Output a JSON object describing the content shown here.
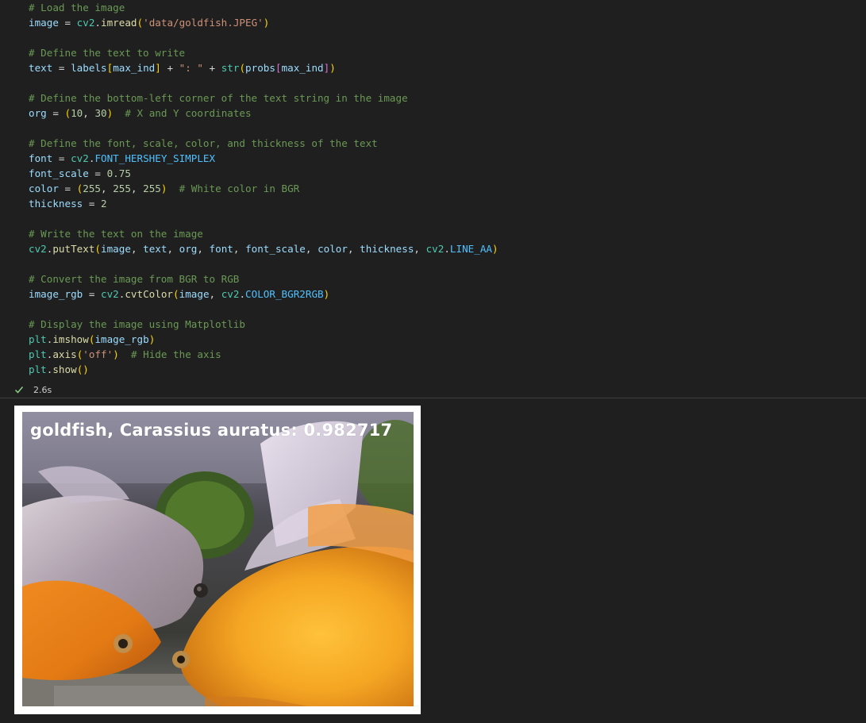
{
  "code_cell": {
    "lines": [
      {
        "segs": [
          [
            "c",
            "# Load the image"
          ]
        ]
      },
      {
        "segs": [
          [
            "v",
            "image"
          ],
          [
            "o",
            " = "
          ],
          [
            "m",
            "cv2"
          ],
          [
            "o",
            "."
          ],
          [
            "f",
            "imread"
          ],
          [
            "p1",
            "("
          ],
          [
            "s",
            "'data/goldfish.JPEG'"
          ],
          [
            "p1",
            ")"
          ]
        ]
      },
      {
        "segs": []
      },
      {
        "segs": [
          [
            "c",
            "# Define the text to write"
          ]
        ]
      },
      {
        "segs": [
          [
            "v",
            "text"
          ],
          [
            "o",
            " = "
          ],
          [
            "v",
            "labels"
          ],
          [
            "p1",
            "["
          ],
          [
            "v",
            "max_ind"
          ],
          [
            "p1",
            "]"
          ],
          [
            "o",
            " + "
          ],
          [
            "s",
            "\": \""
          ],
          [
            "o",
            " + "
          ],
          [
            "m",
            "str"
          ],
          [
            "p1",
            "("
          ],
          [
            "v",
            "probs"
          ],
          [
            "p2",
            "["
          ],
          [
            "v",
            "max_ind"
          ],
          [
            "p2",
            "]"
          ],
          [
            "p1",
            ")"
          ]
        ]
      },
      {
        "segs": []
      },
      {
        "segs": [
          [
            "c",
            "# Define the bottom-left corner of the text string in the image"
          ]
        ]
      },
      {
        "segs": [
          [
            "v",
            "org"
          ],
          [
            "o",
            " = "
          ],
          [
            "p1",
            "("
          ],
          [
            "n",
            "10"
          ],
          [
            "o",
            ", "
          ],
          [
            "n",
            "30"
          ],
          [
            "p1",
            ")"
          ],
          [
            "o",
            "  "
          ],
          [
            "c",
            "# X and Y coordinates"
          ]
        ]
      },
      {
        "segs": []
      },
      {
        "segs": [
          [
            "c",
            "# Define the font, scale, color, and thickness of the text"
          ]
        ]
      },
      {
        "segs": [
          [
            "v",
            "font"
          ],
          [
            "o",
            " = "
          ],
          [
            "m",
            "cv2"
          ],
          [
            "o",
            "."
          ],
          [
            "k",
            "FONT_HERSHEY_SIMPLEX"
          ]
        ]
      },
      {
        "segs": [
          [
            "v",
            "font_scale"
          ],
          [
            "o",
            " = "
          ],
          [
            "n",
            "0.75"
          ]
        ]
      },
      {
        "segs": [
          [
            "v",
            "color"
          ],
          [
            "o",
            " = "
          ],
          [
            "p1",
            "("
          ],
          [
            "n",
            "255"
          ],
          [
            "o",
            ", "
          ],
          [
            "n",
            "255"
          ],
          [
            "o",
            ", "
          ],
          [
            "n",
            "255"
          ],
          [
            "p1",
            ")"
          ],
          [
            "o",
            "  "
          ],
          [
            "c",
            "# White color in BGR"
          ]
        ]
      },
      {
        "segs": [
          [
            "v",
            "thickness"
          ],
          [
            "o",
            " = "
          ],
          [
            "n",
            "2"
          ]
        ]
      },
      {
        "segs": []
      },
      {
        "segs": [
          [
            "c",
            "# Write the text on the image"
          ]
        ]
      },
      {
        "segs": [
          [
            "m",
            "cv2"
          ],
          [
            "o",
            "."
          ],
          [
            "f",
            "putText"
          ],
          [
            "p1",
            "("
          ],
          [
            "v",
            "image"
          ],
          [
            "o",
            ", "
          ],
          [
            "v",
            "text"
          ],
          [
            "o",
            ", "
          ],
          [
            "v",
            "org"
          ],
          [
            "o",
            ", "
          ],
          [
            "v",
            "font"
          ],
          [
            "o",
            ", "
          ],
          [
            "v",
            "font_scale"
          ],
          [
            "o",
            ", "
          ],
          [
            "v",
            "color"
          ],
          [
            "o",
            ", "
          ],
          [
            "v",
            "thickness"
          ],
          [
            "o",
            ", "
          ],
          [
            "m",
            "cv2"
          ],
          [
            "o",
            "."
          ],
          [
            "k",
            "LINE_AA"
          ],
          [
            "p1",
            ")"
          ]
        ]
      },
      {
        "segs": []
      },
      {
        "segs": [
          [
            "c",
            "# Convert the image from BGR to RGB"
          ]
        ]
      },
      {
        "segs": [
          [
            "v",
            "image_rgb"
          ],
          [
            "o",
            " = "
          ],
          [
            "m",
            "cv2"
          ],
          [
            "o",
            "."
          ],
          [
            "f",
            "cvtColor"
          ],
          [
            "p1",
            "("
          ],
          [
            "v",
            "image"
          ],
          [
            "o",
            ", "
          ],
          [
            "m",
            "cv2"
          ],
          [
            "o",
            "."
          ],
          [
            "k",
            "COLOR_BGR2RGB"
          ],
          [
            "p1",
            ")"
          ]
        ]
      },
      {
        "segs": []
      },
      {
        "segs": [
          [
            "c",
            "# Display the image using Matplotlib"
          ]
        ]
      },
      {
        "segs": [
          [
            "m",
            "plt"
          ],
          [
            "o",
            "."
          ],
          [
            "f",
            "imshow"
          ],
          [
            "p1",
            "("
          ],
          [
            "v",
            "image_rgb"
          ],
          [
            "p1",
            ")"
          ]
        ]
      },
      {
        "segs": [
          [
            "m",
            "plt"
          ],
          [
            "o",
            "."
          ],
          [
            "f",
            "axis"
          ],
          [
            "p1",
            "("
          ],
          [
            "s",
            "'off'"
          ],
          [
            "p1",
            ")"
          ],
          [
            "o",
            "  "
          ],
          [
            "c",
            "# Hide the axis"
          ]
        ]
      },
      {
        "segs": [
          [
            "m",
            "plt"
          ],
          [
            "o",
            "."
          ],
          [
            "f",
            "show"
          ],
          [
            "p1",
            "()"
          ]
        ]
      }
    ]
  },
  "status": {
    "icon": "check-icon",
    "duration": "2.6s",
    "color": "#89d185"
  },
  "output": {
    "image_label": "goldfish, Carassius auratus: 0.982717"
  },
  "theme": {
    "background": "#1f1f1f",
    "comment": "#6a9955",
    "variable": "#9cdcfe",
    "function": "#dcdcaa",
    "string": "#ce9178",
    "number": "#b5cea8"
  }
}
